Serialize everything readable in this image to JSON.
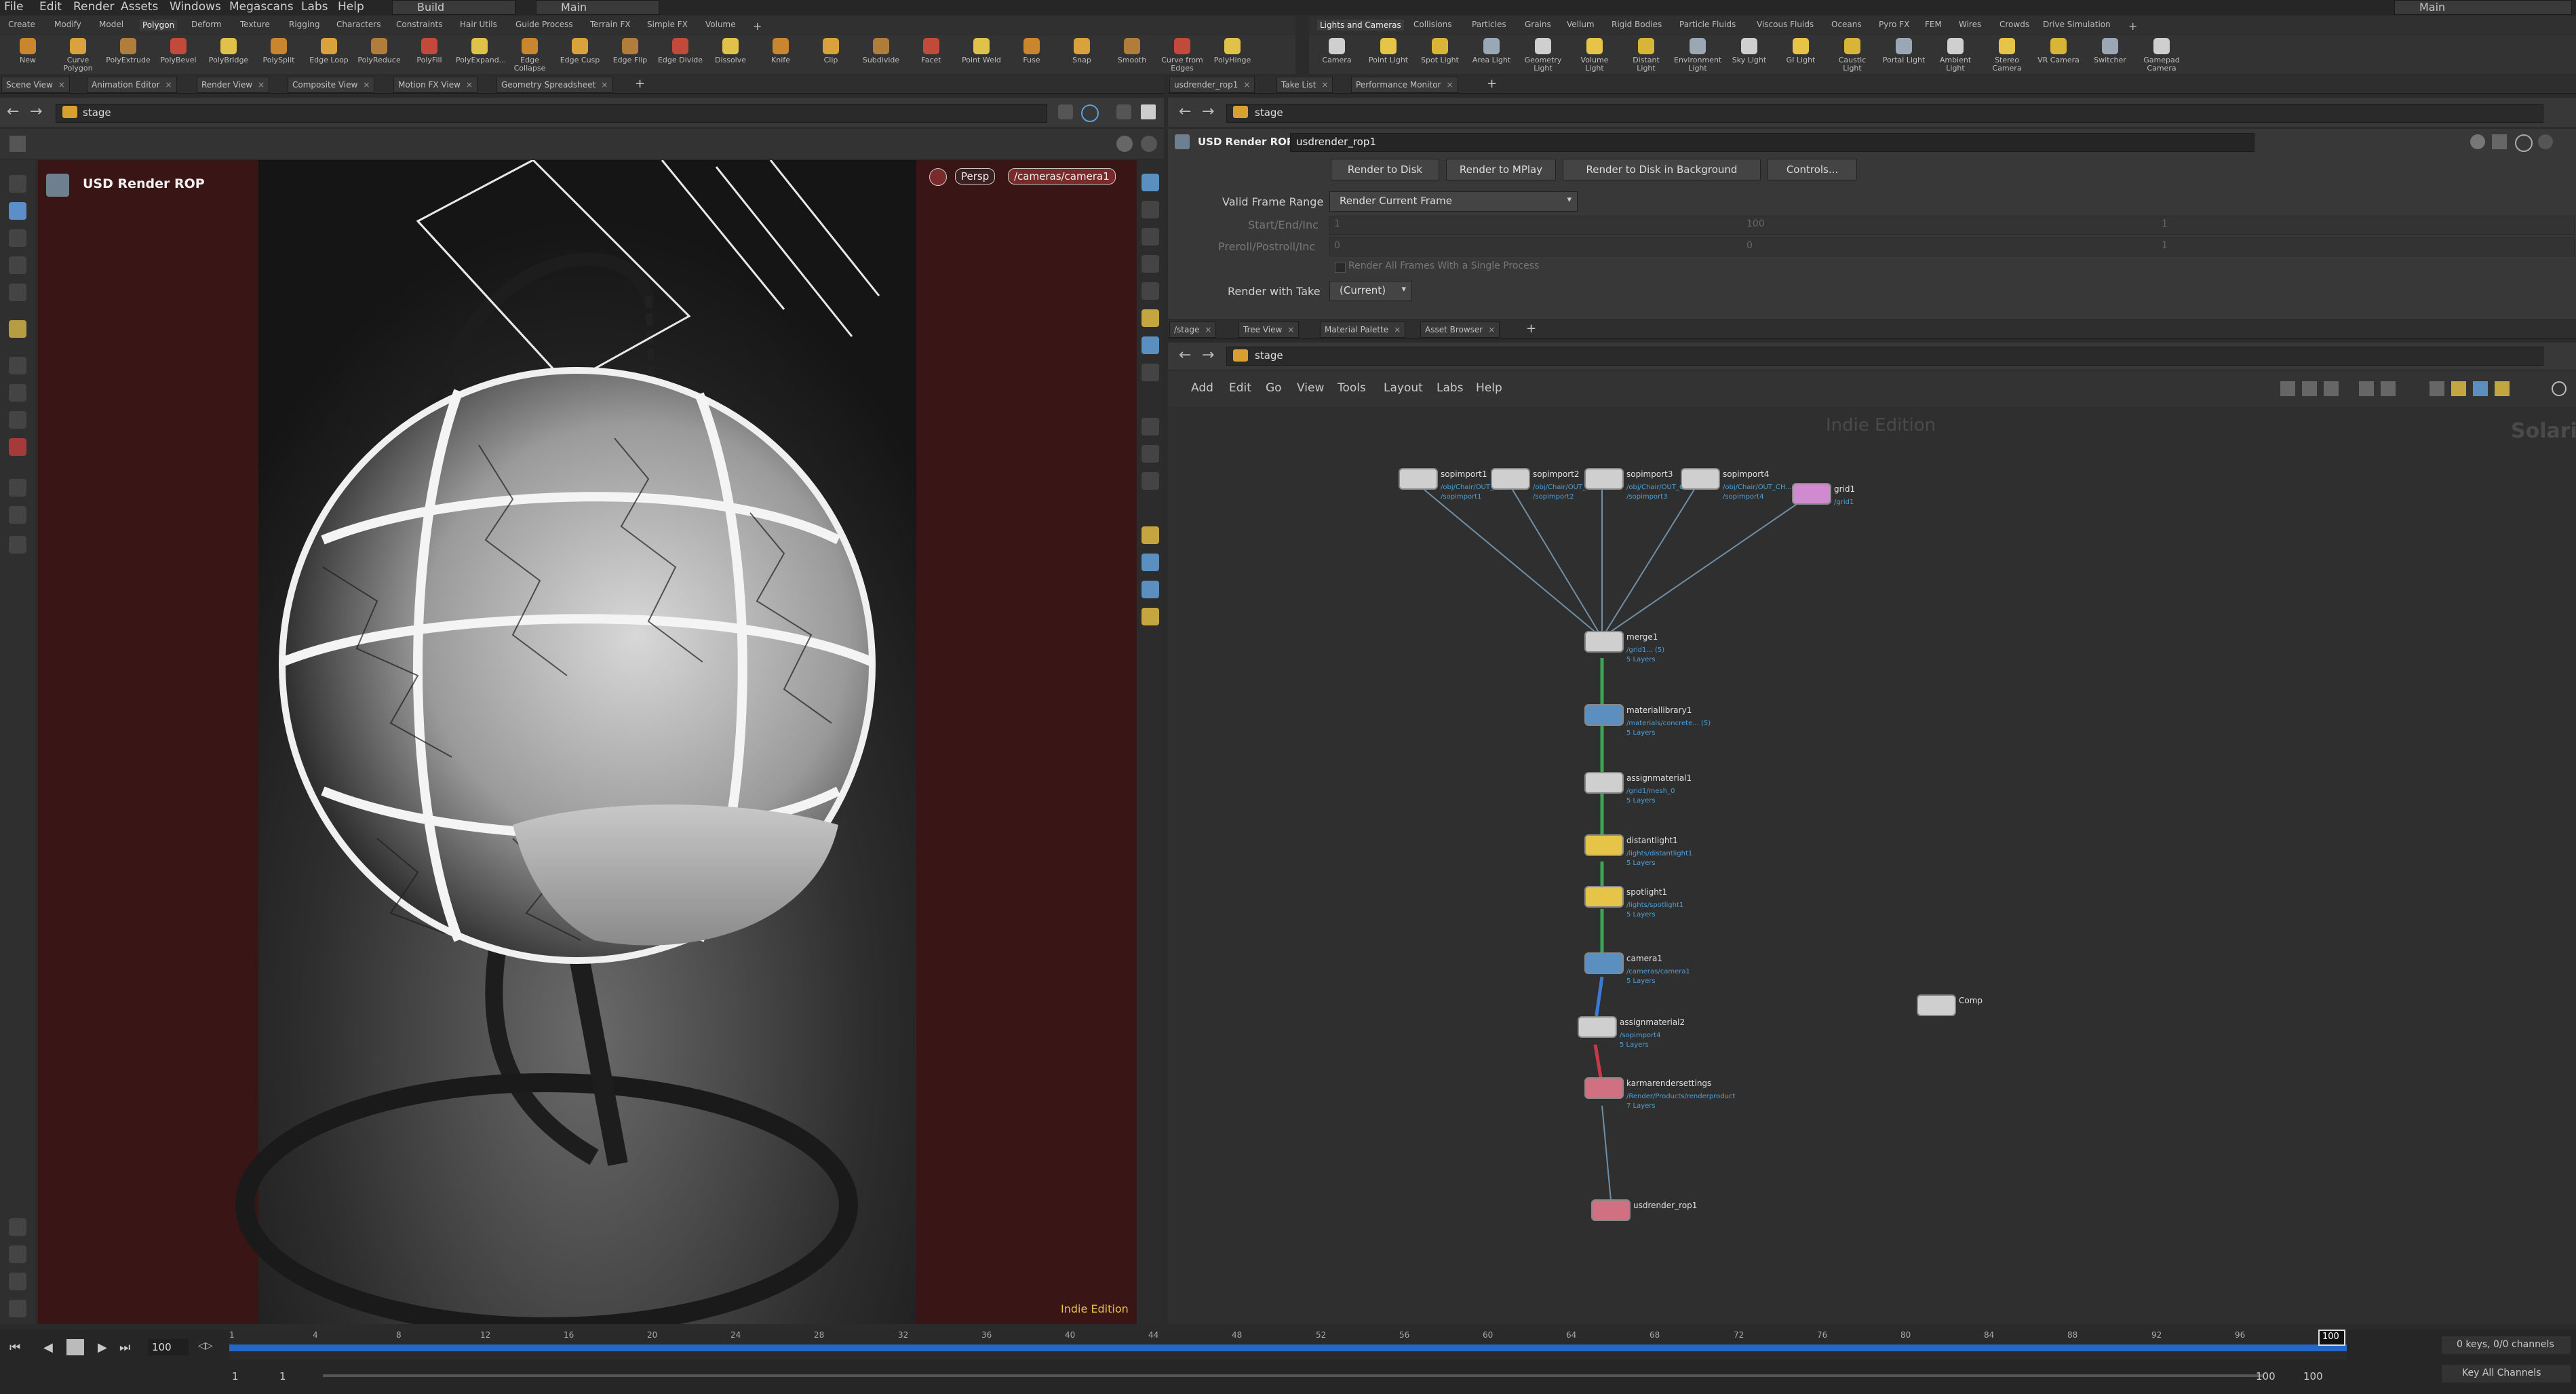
{
  "menu": [
    "File",
    "Edit",
    "Render",
    "Assets",
    "Windows",
    "Megascans",
    "Labs",
    "Help"
  ],
  "desktop": {
    "build": "Build",
    "main": "Main",
    "main_right": "Main"
  },
  "shelf_tabs_left": [
    "Create",
    "Modify",
    "Model",
    "Polygon",
    "Deform",
    "Texture",
    "Rigging",
    "Characters",
    "Constraints",
    "Hair Utils",
    "Guide Process",
    "Terrain FX",
    "Simple FX",
    "Volume"
  ],
  "shelf_tabs_right": [
    "Lights and Cameras",
    "Collisions",
    "Particles",
    "Grains",
    "Vellum",
    "Rigid Bodies",
    "Particle Fluids",
    "Viscous Fluids",
    "Oceans",
    "Pyro FX",
    "FEM",
    "Wires",
    "Crowds",
    "Drive Simulation"
  ],
  "tools_left": [
    "New",
    "Curve Polygon",
    "PolyExtrude",
    "PolyBevel",
    "PolyBridge",
    "PolySplit",
    "Edge Loop",
    "PolyReduce",
    "PolyFill",
    "PolyExpand...",
    "Edge Collapse",
    "Edge Cusp",
    "Edge Flip",
    "Edge Divide",
    "Dissolve",
    "Knife",
    "Clip",
    "Subdivide",
    "Facet",
    "Point Weld",
    "Fuse",
    "Snap",
    "Smooth",
    "Curve from Edges",
    "PolyHinge"
  ],
  "tools_right": [
    "Camera",
    "Point Light",
    "Spot Light",
    "Area Light",
    "Geometry Light",
    "Volume Light",
    "Distant Light",
    "Environment Light",
    "Sky Light",
    "GI Light",
    "Caustic Light",
    "Portal Light",
    "Ambient Light",
    "Stereo Camera",
    "VR Camera",
    "Switcher",
    "Gamepad Camera"
  ],
  "left_pane_tabs": [
    "Scene View",
    "Animation Editor",
    "Render View",
    "Composite View",
    "Motion FX View",
    "Geometry Spreadsheet"
  ],
  "left_path": "stage",
  "viewport": {
    "title": "USD Render ROP",
    "persp": "Persp",
    "camera": "/cameras/camera1",
    "edition": "Indie Edition"
  },
  "right_top_tabs": [
    "usdrender_rop1",
    "Take List",
    "Performance Monitor"
  ],
  "right_top_path": "stage",
  "parm": {
    "node_type": "USD Render ROP",
    "node_name": "usdrender_rop1",
    "buttons": [
      "Render to Disk",
      "Render to MPlay",
      "Render to Disk in Background",
      "Controls..."
    ],
    "valid_frame_label": "Valid Frame Range",
    "valid_frame_value": "Render Current Frame",
    "start_label": "Start/End/Inc",
    "start_vals": [
      "1",
      "100",
      "1"
    ],
    "preroll_label": "Preroll/Postroll/Inc",
    "preroll_vals": [
      "0",
      "0",
      "1"
    ],
    "single_process": "Render All Frames With a Single Process",
    "take_label": "Render with Take",
    "take_value": "(Current)"
  },
  "net_tabs": [
    "/stage",
    "Tree View",
    "Material Palette",
    "Asset Browser"
  ],
  "net_path": "stage",
  "net_menu": [
    "Add",
    "Edit",
    "Go",
    "View",
    "Tools",
    "Layout",
    "Labs",
    "Help"
  ],
  "net_watermark": "Indie Edition",
  "net_corner": "Solari",
  "nodes": {
    "sop1": {
      "name": "sopimport1",
      "sub": "/obj/Chair/OUT_CHAIR\n/sopimport1"
    },
    "sop2": {
      "name": "sopimport2",
      "sub": "/obj/Chair/OUT_FRAME\n/sopimport2"
    },
    "sop3": {
      "name": "sopimport3",
      "sub": "/obj/Chair/OUT_CUSHION\n/sopimport3"
    },
    "sop4": {
      "name": "sopimport4",
      "sub": "/obj/Chair/OUT_CH...\n/sopimport4"
    },
    "grid": {
      "name": "grid1",
      "sub": "/grid1"
    },
    "merge": {
      "name": "merge1",
      "sub": "/grid1... (5)\n5 Layers"
    },
    "matlib": {
      "name": "materiallibrary1",
      "sub": "/materials/concrete... (5)\n5 Layers"
    },
    "assign1": {
      "name": "assignmaterial1",
      "sub": "/grid1/mesh_0\n5 Layers"
    },
    "distant": {
      "name": "distantlight1",
      "sub": "/lights/distantlight1\n5 Layers"
    },
    "spot": {
      "name": "spotlight1",
      "sub": "/lights/spotlight1\n5 Layers"
    },
    "camera": {
      "name": "camera1",
      "sub": "/cameras/camera1\n5 Layers"
    },
    "assign2": {
      "name": "assignmaterial2",
      "sub": "/sopimport4\n5 Layers"
    },
    "karma": {
      "name": "karmarendersettings",
      "sub": "/Render/Products/renderproduct\n7 Layers"
    },
    "rop": {
      "name": "usdrender_rop1",
      "sub": ""
    },
    "comp": {
      "name": "Comp",
      "sub": ""
    }
  },
  "timeline": {
    "frame": "100",
    "start": "1",
    "start2": "1",
    "end": "100",
    "end2": "100",
    "keys": "0 keys, 0/0 channels",
    "key_all": "Key All Channels",
    "ticks": [
      "1",
      "4",
      "8",
      "12",
      "16",
      "20",
      "24",
      "28",
      "32",
      "36",
      "40",
      "44",
      "48",
      "52",
      "56",
      "60",
      "64",
      "68",
      "72",
      "76",
      "80",
      "84",
      "88",
      "92",
      "96",
      "100"
    ]
  }
}
